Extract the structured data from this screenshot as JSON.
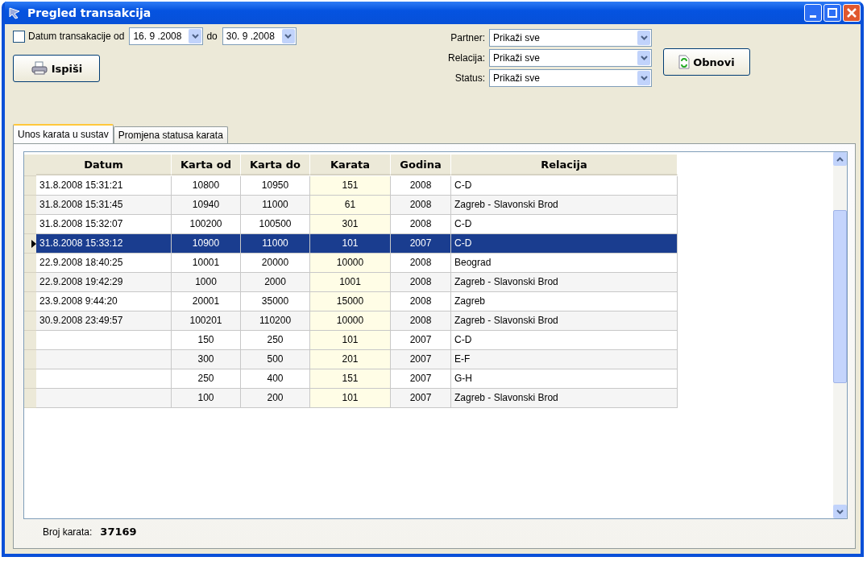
{
  "window": {
    "title": "Pregled transakcija"
  },
  "date_filter": {
    "label": "Datum transakacije od",
    "checked": false,
    "from": "16. 9 .2008",
    "to_label": "do",
    "to": "30. 9 .2008"
  },
  "print_button": {
    "label": "Ispiši"
  },
  "filters": [
    {
      "label": "Partner:",
      "value": "Prikaži sve"
    },
    {
      "label": "Relacija:",
      "value": "Prikaži sve"
    },
    {
      "label": "Status:",
      "value": "Prikaži sve"
    }
  ],
  "refresh_button": {
    "label": "Obnovi"
  },
  "tabs": [
    {
      "label": "Unos karata u sustav",
      "selected": true
    },
    {
      "label": "Promjena statusa karata",
      "selected": false
    }
  ],
  "table": {
    "columns": [
      "Datum",
      "Karta od",
      "Karta do",
      "Karata",
      "Godina",
      "Relacija"
    ],
    "rows": [
      {
        "cells": [
          "31.8.2008 15:31:21",
          "10800",
          "10950",
          "151",
          "2008",
          "C-D"
        ],
        "selected": false
      },
      {
        "cells": [
          "31.8.2008 15:31:45",
          "10940",
          "11000",
          "61",
          "2008",
          "Zagreb - Slavonski Brod"
        ],
        "selected": false
      },
      {
        "cells": [
          "31.8.2008 15:32:07",
          "100200",
          "100500",
          "301",
          "2008",
          "C-D"
        ],
        "selected": false
      },
      {
        "cells": [
          "31.8.2008 15:33:12",
          "10900",
          "11000",
          "101",
          "2007",
          "C-D"
        ],
        "selected": true
      },
      {
        "cells": [
          "22.9.2008 18:40:25",
          "10001",
          "20000",
          "10000",
          "2008",
          "Beograd"
        ],
        "selected": false
      },
      {
        "cells": [
          "22.9.2008 19:42:29",
          "1000",
          "2000",
          "1001",
          "2008",
          "Zagreb - Slavonski Brod"
        ],
        "selected": false
      },
      {
        "cells": [
          "23.9.2008 9:44:20",
          "20001",
          "35000",
          "15000",
          "2008",
          "Zagreb"
        ],
        "selected": false
      },
      {
        "cells": [
          "30.9.2008 23:49:57",
          "100201",
          "110200",
          "10000",
          "2008",
          "Zagreb - Slavonski Brod"
        ],
        "selected": false
      },
      {
        "cells": [
          "",
          "150",
          "250",
          "101",
          "2007",
          "C-D"
        ],
        "selected": false
      },
      {
        "cells": [
          "",
          "300",
          "500",
          "201",
          "2007",
          "E-F"
        ],
        "selected": false
      },
      {
        "cells": [
          "",
          "250",
          "400",
          "151",
          "2007",
          "G-H"
        ],
        "selected": false
      },
      {
        "cells": [
          "",
          "100",
          "200",
          "101",
          "2007",
          "Zagreb - Slavonski Brod"
        ],
        "selected": false
      }
    ]
  },
  "footer": {
    "label": "Broj karata:",
    "value": "37169"
  }
}
